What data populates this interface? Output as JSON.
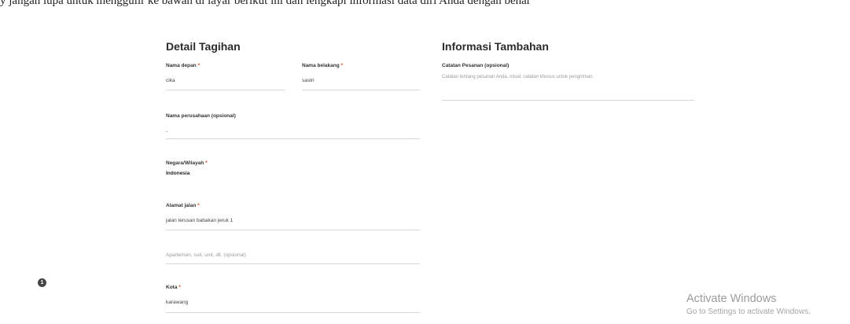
{
  "caption": "y jangan lupa untuk menggulir ke bawah di layar berikut ini dan lengkapi informasi data diri Anda dengan benar",
  "billing": {
    "title": "Detail Tagihan",
    "first_name": {
      "label": "Nama depan",
      "required": "*",
      "value": "cika"
    },
    "last_name": {
      "label": "Nama belakang",
      "required": "*",
      "value": "sastri"
    },
    "company": {
      "label": "Nama perusahaan (opsional)",
      "value": "-"
    },
    "country": {
      "label": "Negara/Wilayah",
      "required": "*",
      "value": "Indonesia"
    },
    "street": {
      "label": "Alamat jalan",
      "required": "*",
      "value": "jalan terusan babakan jeruk 1"
    },
    "apartment": {
      "placeholder": "Apartemen, suit, unit, dll. (opsional)"
    },
    "city": {
      "label": "Kota",
      "required": "*",
      "value": "karawang"
    }
  },
  "additional": {
    "title": "Informasi Tambahan",
    "notes": {
      "label": "Catatan Pesanan (opsional)",
      "placeholder": "Catatan tentang pesanan Anda, misal: catatan khusus untuk pengiriman."
    }
  },
  "step_badge": "1",
  "watermark": {
    "title": "Activate Windows",
    "subtitle": "Go to Settings to activate Windows."
  }
}
